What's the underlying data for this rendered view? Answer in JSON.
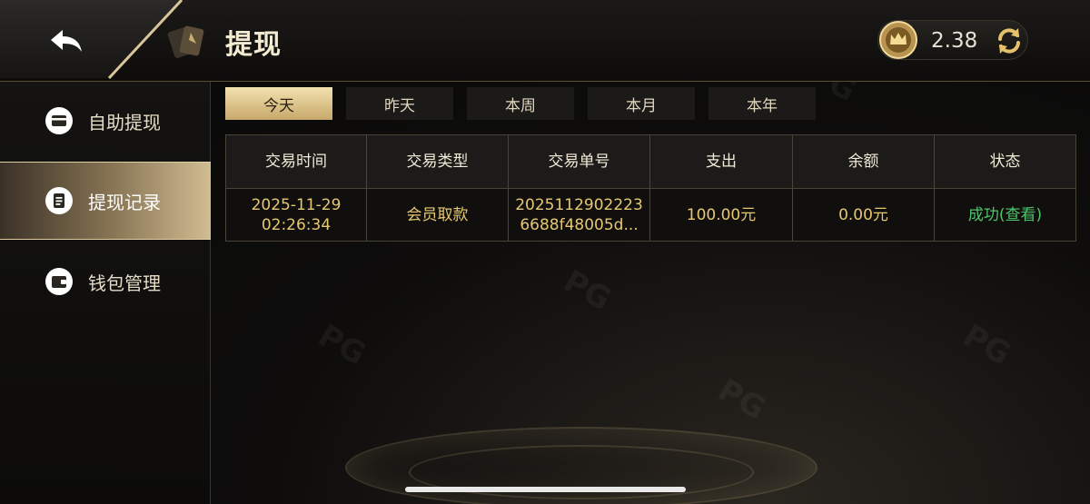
{
  "header": {
    "title": "提现",
    "balance": "2.38"
  },
  "sidebar": {
    "items": [
      {
        "label": "自助提现",
        "icon": "card-icon",
        "active": false
      },
      {
        "label": "提现记录",
        "icon": "record-icon",
        "active": true
      },
      {
        "label": "钱包管理",
        "icon": "wallet-icon",
        "active": false
      }
    ]
  },
  "tabs": [
    {
      "label": "今天",
      "active": true
    },
    {
      "label": "昨天",
      "active": false
    },
    {
      "label": "本周",
      "active": false
    },
    {
      "label": "本月",
      "active": false
    },
    {
      "label": "本年",
      "active": false
    }
  ],
  "table": {
    "headers": [
      "交易时间",
      "交易类型",
      "交易单号",
      "支出",
      "余额",
      "状态"
    ],
    "rows": [
      {
        "date": "2025-11-29",
        "time": "02:26:34",
        "type": "会员取款",
        "order_no": "20251129022236688f48005d...",
        "amount": "100.00元",
        "balance": "0.00元",
        "status": "成功(查看)"
      }
    ]
  },
  "colors": {
    "accent_gold": "#e6c872",
    "success_green": "#4fc56a",
    "tab_active": "#e6d29e"
  }
}
